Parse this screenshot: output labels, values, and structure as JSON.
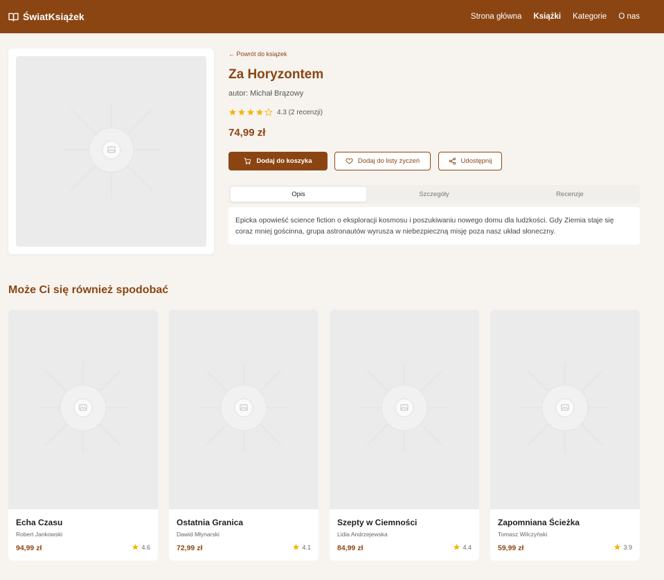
{
  "brand": {
    "name": "ŚwiatKsiążek",
    "icon": "book-open-icon"
  },
  "nav": [
    {
      "label": "Strona główna",
      "active": false
    },
    {
      "label": "Książki",
      "active": true
    },
    {
      "label": "Kategorie",
      "active": false
    },
    {
      "label": "O nas",
      "active": false
    }
  ],
  "book": {
    "back_label": "← Powrót do książek",
    "title": "Za Horyzontem",
    "author": "autor: Michał Brązowy",
    "rating": 4.3,
    "rating_text": "4.3 (2 recenzji)",
    "price": "74,99 zł"
  },
  "actions": {
    "add_to_cart": "Dodaj do koszyka",
    "add_to_wishlist": "Dodaj do listy życzeń",
    "share": "Udostępnij"
  },
  "tabs": [
    {
      "label": "Opis",
      "active": true
    },
    {
      "label": "Szczegóły",
      "active": false
    },
    {
      "label": "Recenzje",
      "active": false
    }
  ],
  "description": "Epicka opowieść science fiction o eksploracji kosmosu i poszukiwaniu nowego domu dla ludzkości. Gdy Ziemia staje się coraz mniej gościnna, grupa astronautów wyrusza w niebezpieczną misję poza nasz układ słoneczny.",
  "related": {
    "title": "Może Ci się również spodobać",
    "items": [
      {
        "title": "Echa Czasu",
        "author": "Robert Jankowski",
        "price": "94,99 zł",
        "rating": "4.6"
      },
      {
        "title": "Ostatnia Granica",
        "author": "Dawid Młynarski",
        "price": "72,99 zł",
        "rating": "4.1"
      },
      {
        "title": "Szepty w Ciemności",
        "author": "Lidia Andrzejewska",
        "price": "84,99 zł",
        "rating": "4.4"
      },
      {
        "title": "Zapomniana Ścieżka",
        "author": "Tomasz Wilczyński",
        "price": "59,99 zł",
        "rating": "3.9"
      }
    ]
  },
  "colors": {
    "brand": "#8b4513",
    "background": "#f7f4ef",
    "star": "#f5b50a"
  }
}
